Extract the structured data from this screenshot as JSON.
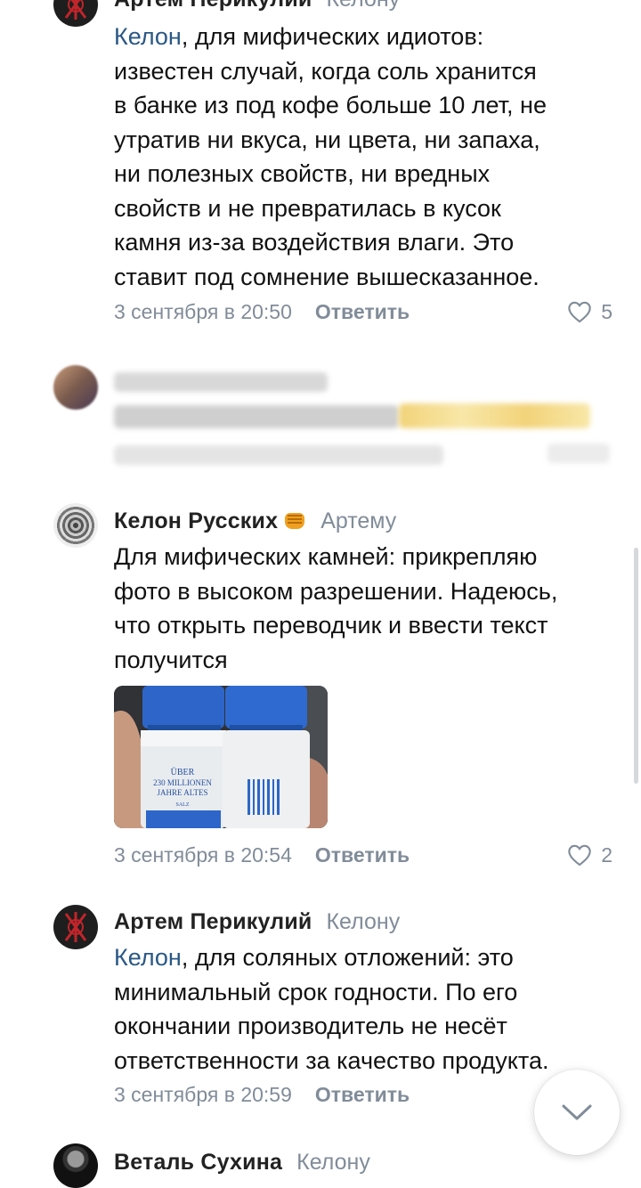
{
  "comments": [
    {
      "author": "Артем Перикулий",
      "reply_to": "Келону",
      "mention": "Келон",
      "text_rest": ", для мифических идиотов:\nизвестен случай, когда соль хранится\nв банке из под кофе больше 10 лет, не\nутратив ни вкуса, ни цвета, ни запаха,\nни полезных свойств, ни вредных\nсвойств и не превратилась в кусок\nкамня из-за воздействия влаги. Это\nставит под сомнение вышесказанное.",
      "date": "3 сентября в 20:50",
      "reply_label": "Ответить",
      "likes": "5"
    },
    {
      "author": "Келон Русских",
      "reply_to": "Артему",
      "text": "Для мифических камней: прикрепляю\nфото в высоком разрешении. Надеюсь,\nчто открыть переводчик и ввести текст\nполучится",
      "photo_label_lines": [
        "ÜBER",
        "230 MILLIONEN",
        "JAHRE ALTES",
        "SALZ"
      ],
      "date": "3 сентября в 20:54",
      "reply_label": "Ответить",
      "likes": "2"
    },
    {
      "author": "Артем Перикулий",
      "reply_to": "Келону",
      "mention": "Келон",
      "text_rest": ", для соляных отложений: это\nминимальный срок годности. По его\nокончании производитель не несёт\nответственности за качество продукта.",
      "date": "3 сентября в 20:59",
      "reply_label": "Ответить"
    },
    {
      "author": "Веталь Сухина",
      "reply_to": "Келону"
    }
  ],
  "icons": {
    "like": "heart-outline-icon",
    "scroll_down": "chevron-down-icon",
    "emoji": "fist-emoji-icon"
  },
  "colors": {
    "link": "#2a5885",
    "secondary": "#818c99",
    "text": "#111111"
  }
}
